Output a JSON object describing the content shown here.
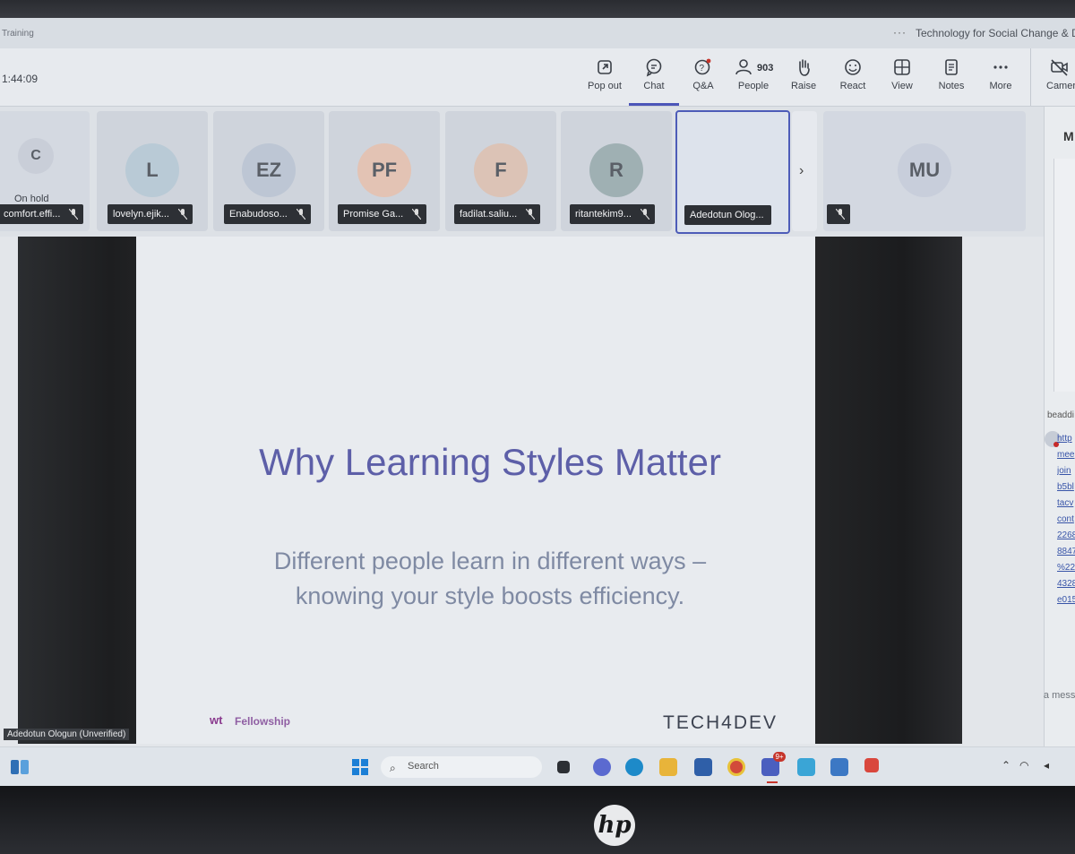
{
  "window": {
    "app_title": "Training",
    "more_dots": "···",
    "meeting_title": "Technology for Social Change & Development"
  },
  "toolbar": {
    "timer": "1:44:09",
    "buttons": [
      {
        "label": "Pop out",
        "icon": "pop-out-icon"
      },
      {
        "label": "Chat",
        "icon": "chat-icon"
      },
      {
        "label": "Q&A",
        "icon": "qa-icon"
      },
      {
        "label": "People",
        "icon": "people-icon",
        "count": "903"
      },
      {
        "label": "Raise",
        "icon": "raise-hand-icon"
      },
      {
        "label": "React",
        "icon": "react-icon"
      },
      {
        "label": "View",
        "icon": "view-icon"
      },
      {
        "label": "Notes",
        "icon": "notes-icon"
      },
      {
        "label": "More",
        "icon": "more-icon"
      },
      {
        "label": "Camera",
        "icon": "camera-off-icon"
      }
    ]
  },
  "participants": [
    {
      "initials": "C",
      "name": "comfort.effi...",
      "status": "On hold",
      "avatar_color": "#c9ced8"
    },
    {
      "initials": "L",
      "name": "lovelyn.ejik...",
      "avatar_color": "#b9cad6"
    },
    {
      "initials": "EZ",
      "name": "Enabudoso...",
      "avatar_color": "#bdc6d4"
    },
    {
      "initials": "PF",
      "name": "Promise Ga...",
      "avatar_color": "#e3c3b4"
    },
    {
      "initials": "F",
      "name": "fadilat.saliu...",
      "avatar_color": "#dcc3b6"
    },
    {
      "initials": "R",
      "name": "ritantekim9...",
      "avatar_color": "#9fb0b3"
    },
    {
      "initials": "",
      "name": "Adedotun Olog...",
      "avatar_color": "#dde3ec"
    },
    {
      "initials": "MU",
      "name": "",
      "avatar_color": "#c8cedb"
    }
  ],
  "strip_arrow": "›",
  "side_panel": {
    "header_initial": "M",
    "chat_sender": "beaddi",
    "chat_link": "http\nmee\njoin\nb5bl\ntacv\ncont\n2268\n8847\n%22%\n4328-\ne0157",
    "input_placeholder": "Type a message"
  },
  "stage": {
    "left_video_label": "Adedotun Ologun (Unverified)",
    "slide_title": "Why Learning Styles Matter",
    "slide_body": "Different people learn in different ways – knowing your style boosts efficiency.",
    "logo_left_mark": "wt",
    "logo_left_text": "Fellowship",
    "logo_right_text": "TECH4DEV"
  },
  "taskbar": {
    "search_label": "Search",
    "notification_badge": "9+"
  },
  "device": {
    "brand": "hp"
  },
  "colors": {
    "accent": "#4b55b8",
    "slide_title": "#5d5fa8",
    "slide_body": "#7f8aa3",
    "badge": "#c6352b"
  }
}
